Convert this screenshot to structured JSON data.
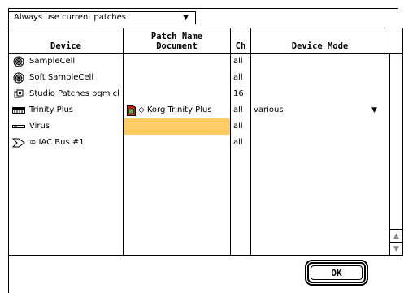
{
  "patch_popup": {
    "label": "Always use current patches",
    "arrow_icon": "triangle-down-icon"
  },
  "columns": {
    "device": "Device",
    "patch_line1": "Patch Name",
    "patch_line2": "Document",
    "channel": "Ch",
    "mode": "Device Mode"
  },
  "rows": [
    {
      "icon": "samplecell-icon",
      "device": "SampleCell",
      "patch": "",
      "channel": "all",
      "mode": ""
    },
    {
      "icon": "samplecell-icon",
      "device": "Soft SampleCell",
      "patch": "",
      "channel": "all",
      "mode": ""
    },
    {
      "icon": "studio-patches-icon",
      "device": "Studio Patches pgm cl",
      "patch": "",
      "channel": "16",
      "mode": ""
    },
    {
      "icon": "keyboard-icon",
      "device": "Trinity Plus",
      "patch_icon": "document-icon",
      "patch": "◇ Korg Trinity Plus",
      "channel": "all",
      "mode": "various",
      "mode_arrow": "triangle-down-icon"
    },
    {
      "icon": "rack-module-icon",
      "device": "Virus",
      "patch": "",
      "channel": "all",
      "mode": ""
    },
    {
      "icon": "iac-bus-icon",
      "device": "∞ IAC Bus #1",
      "patch": "",
      "channel": "all",
      "mode": ""
    }
  ],
  "ok_button": {
    "label": "OK"
  },
  "colors": {
    "selection": "#ffcc66",
    "frame": "#000000"
  }
}
